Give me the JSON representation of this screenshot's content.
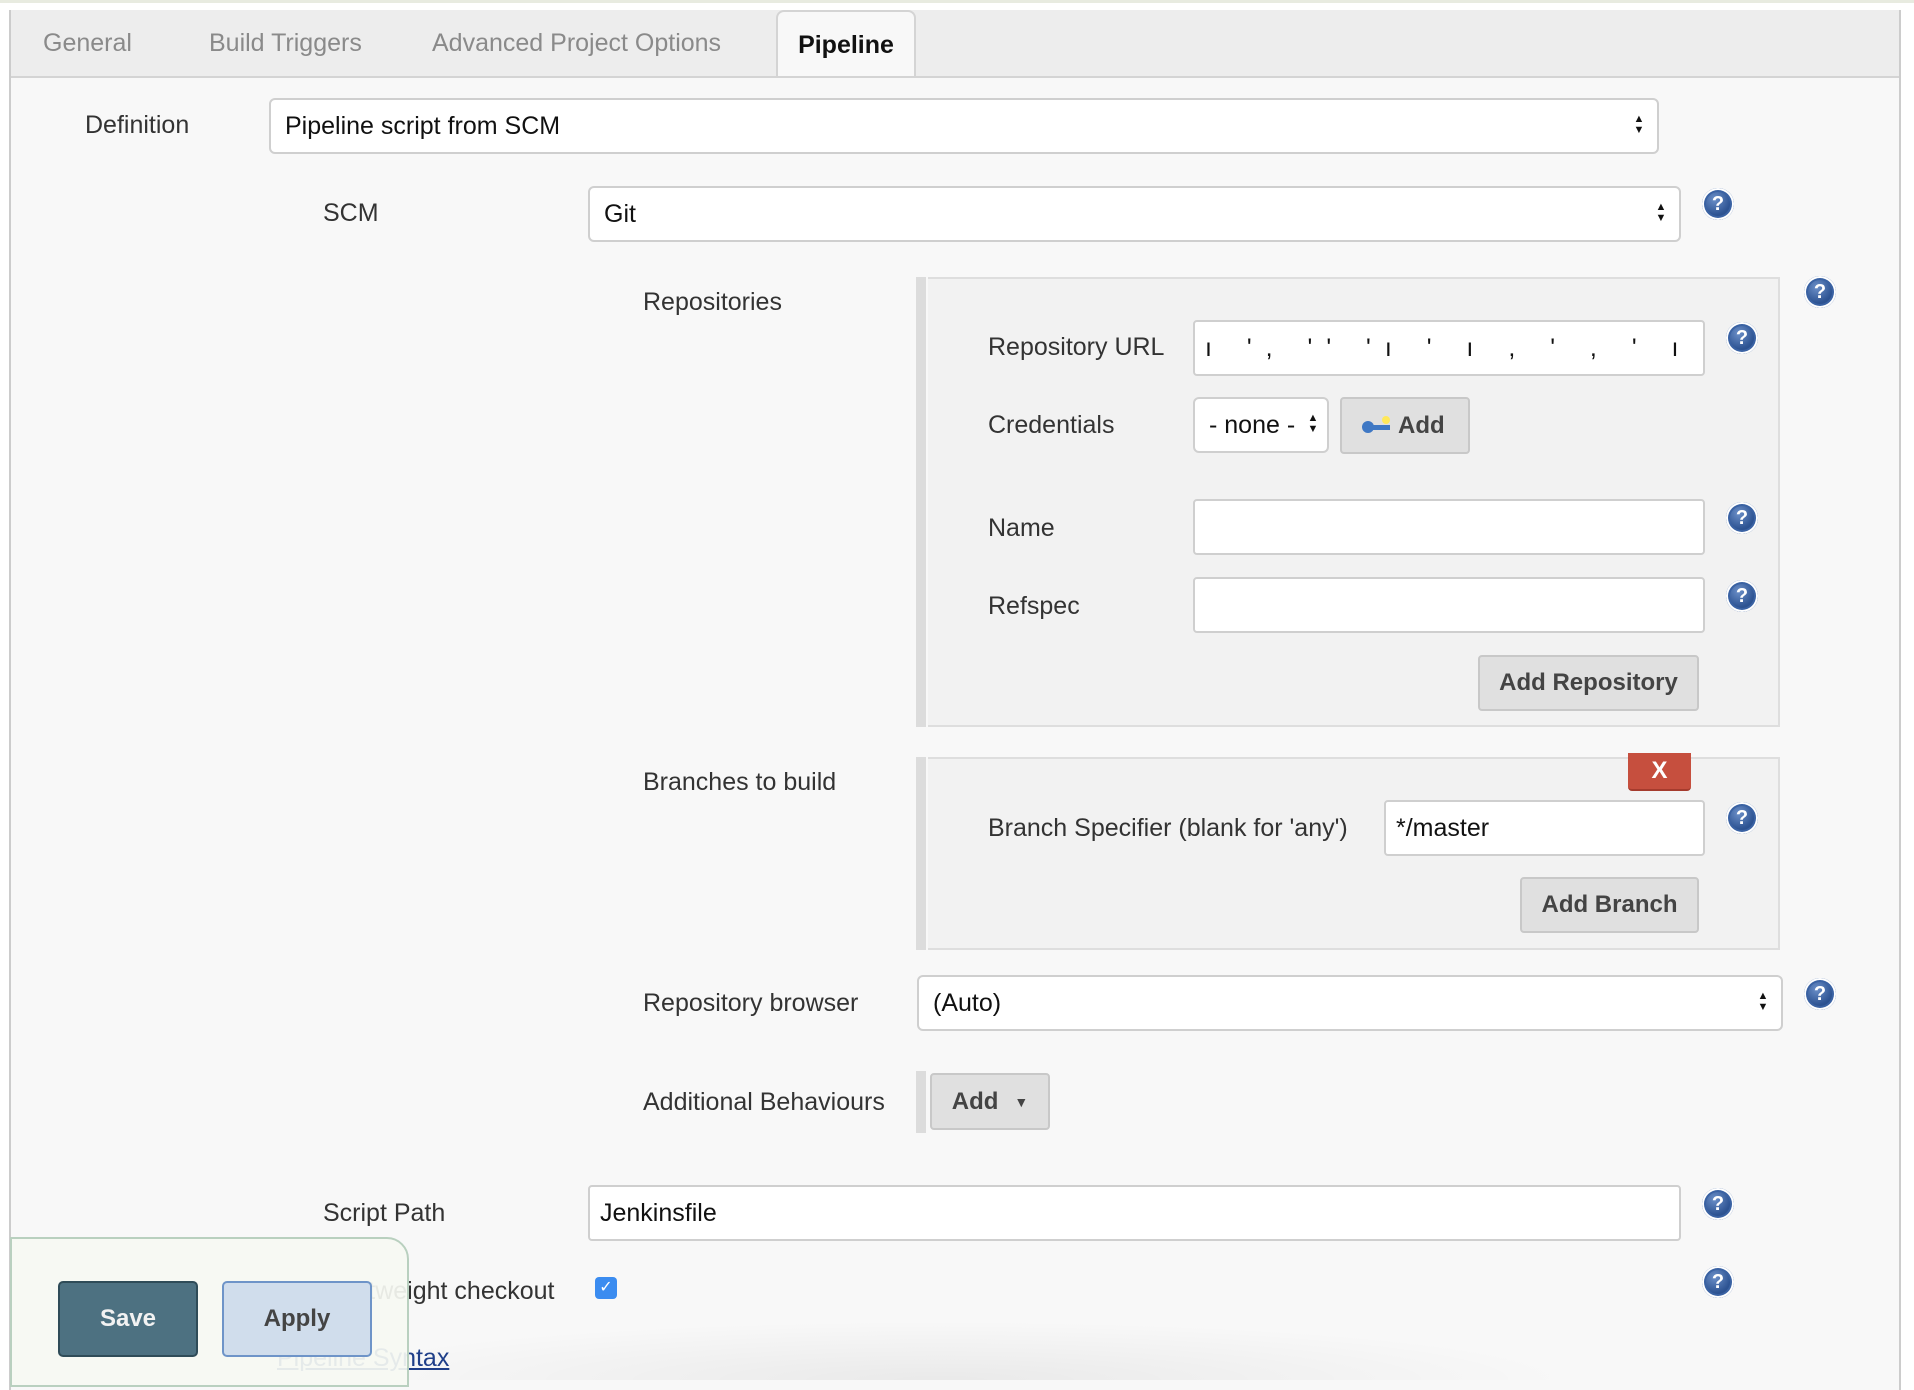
{
  "tabs": [
    {
      "label": "General",
      "active": false
    },
    {
      "label": "Build Triggers",
      "active": false
    },
    {
      "label": "Advanced Project Options",
      "active": false
    },
    {
      "label": "Pipeline",
      "active": true
    }
  ],
  "definition": {
    "label": "Definition",
    "value": "Pipeline script from SCM"
  },
  "scm": {
    "label": "SCM",
    "value": "Git"
  },
  "repositories": {
    "label": "Repositories",
    "repository_url_label": "Repository URL",
    "repository_url_value": "[redacted URL]",
    "credentials_label": "Credentials",
    "credentials_value": "- none -",
    "credentials_add_label": "Add",
    "name_label": "Name",
    "name_value": "",
    "refspec_label": "Refspec",
    "refspec_value": "",
    "add_repository_label": "Add Repository"
  },
  "branches": {
    "label": "Branches to build",
    "delete_label": "X",
    "branch_specifier_label": "Branch Specifier (blank for 'any')",
    "branch_specifier_value": "*/master",
    "add_branch_label": "Add Branch"
  },
  "repository_browser": {
    "label": "Repository browser",
    "value": "(Auto)"
  },
  "additional_behaviours": {
    "label": "Additional Behaviours",
    "add_label": "Add"
  },
  "script_path": {
    "label": "Script Path",
    "value": "Jenkinsfile"
  },
  "lightweight_checkout": {
    "label": "Lightweight checkout",
    "checked": true
  },
  "pipeline_syntax_link": "Pipeline Syntax",
  "footer": {
    "save_label": "Save",
    "apply_label": "Apply"
  },
  "icons": {
    "help": "?",
    "select_arrows": "▲▼",
    "dropdown_caret": "▼",
    "checkmark": "✓"
  }
}
